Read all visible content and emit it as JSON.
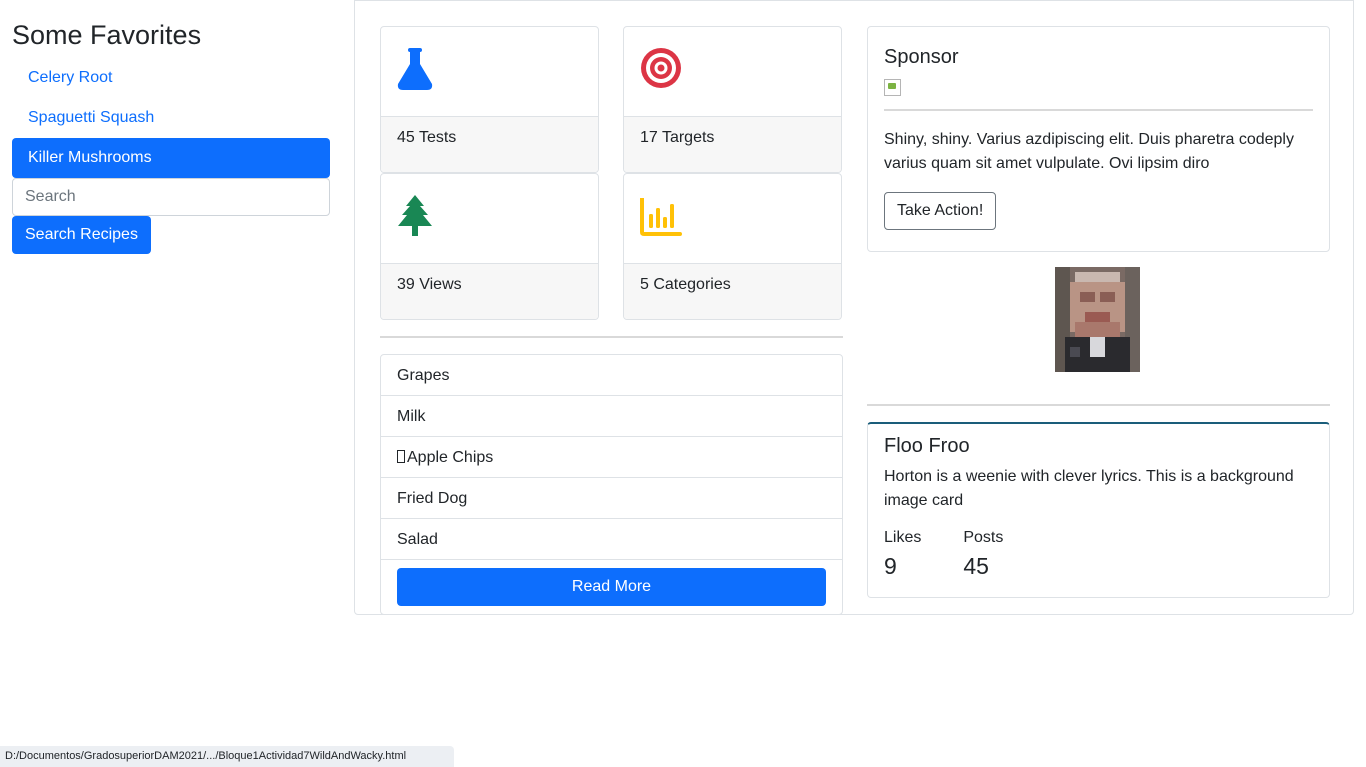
{
  "sidebar": {
    "title": "Some Favorites",
    "items": [
      {
        "label": "Celery Root"
      },
      {
        "label": "Spaguetti Squash"
      },
      {
        "label": "Killer Mushrooms"
      }
    ],
    "search_placeholder": "Search",
    "search_button": "Search Recipes"
  },
  "stats": [
    {
      "label": "45 Tests",
      "icon": "flask-icon",
      "color": "#0d6efd"
    },
    {
      "label": "17 Targets",
      "icon": "target-icon",
      "color": "#dc3545"
    },
    {
      "label": "39 Views",
      "icon": "tree-icon",
      "color": "#198754"
    },
    {
      "label": "5 Categories",
      "icon": "bar-chart-icon",
      "color": "#ffc107"
    }
  ],
  "list": {
    "items": [
      "Grapes",
      "Milk",
      "Apple Chips",
      "Fried Dog",
      "Salad"
    ],
    "button": "Read More"
  },
  "sponsor": {
    "title": "Sponsor",
    "text": "Shiny, shiny. Varius azdipiscing elit. Duis pharetra codeply varius quam sit amet vulpulate. Ovi lipsim diro",
    "button": "Take Action!"
  },
  "profile": {
    "name": "Floo Froo",
    "text": "Horton is a weenie with clever lyrics. This is a background image card",
    "likes_label": "Likes",
    "likes": "9",
    "posts_label": "Posts",
    "posts": "45"
  },
  "status_bar": "D:/Documentos/GradosuperiorDAM2021/.../Bloque1Actividad7WildAndWacky.html"
}
